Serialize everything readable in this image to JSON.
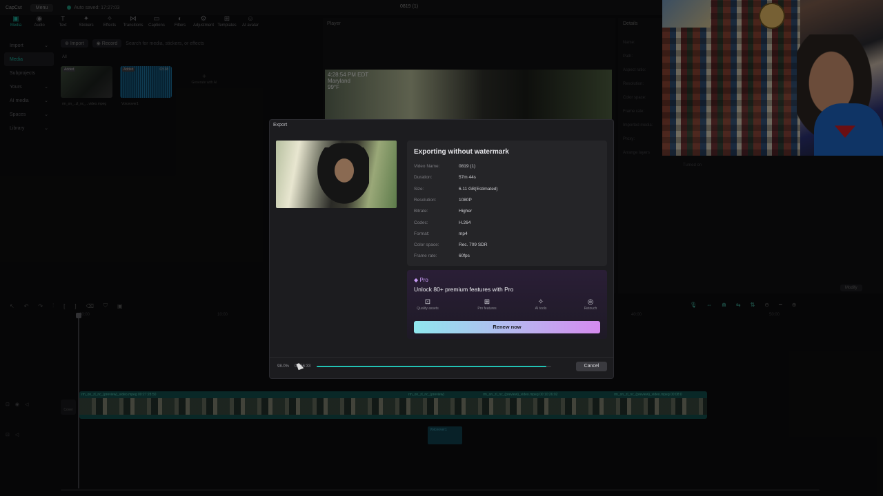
{
  "topbar": {
    "logo": "CapCut",
    "menu": "Menu",
    "autosave": "Auto saved: 17:27:03",
    "window_title": "0819 (1)"
  },
  "toolbar": [
    "Media",
    "Audio",
    "Text",
    "Stickers",
    "Effects",
    "Transitions",
    "Captions",
    "Filters",
    "Adjustment",
    "Templates",
    "AI avatar"
  ],
  "toolbar_icons": [
    "▣",
    "◉",
    "T",
    "✦",
    "✧",
    "⋈",
    "▭",
    "◐",
    "⚙",
    "⊞",
    "☺"
  ],
  "leftnav": [
    "Import",
    "Media",
    "Subprojects",
    "Yours",
    "AI media",
    "Spaces",
    "Library"
  ],
  "media": {
    "import": "Import",
    "record": "Record",
    "search_placeholder": "Search for media, stickers, or effects",
    "all": "All",
    "added": "Added",
    "thumb1_name": "rm_on_..zl_nc_...video.mpeg",
    "thumb2_name": "Voiceover1",
    "thumb2_duration": "03:38",
    "import_ai": "Generate with AI"
  },
  "player": {
    "label": "Player",
    "overlay_time": "4:28:54 PM EDT",
    "overlay_place": "Maryland",
    "overlay_temp": "99°F"
  },
  "details": {
    "label": "Details",
    "lines": [
      "Name:",
      "Path:",
      "Aspect ratio:",
      "Resolution:",
      "Color space:",
      "Frame rate:",
      "Imported media:",
      "Proxy:",
      "Arrange layers"
    ],
    "arrange_value": "Turned on",
    "modify": "Modify"
  },
  "timeline": {
    "ruler_labels": [
      "00:00",
      "10:00",
      "20:00",
      "30:00",
      "40:00",
      "50:00"
    ],
    "clip_labels": [
      "rm_on_zl_nc_(preview)_video.mpeg   00:27:28:50",
      "rm_on_zl_nc_(preview)",
      "rm_on_zl_nc_(preview)_video.mpeg   00:10:26:02",
      "rm_on_zl_nc_(preview)_video.mpeg   00:08:0"
    ],
    "cover": "Cover",
    "voice_clip": "Voiceover1"
  },
  "export_modal": {
    "title": "Export",
    "heading": "Exporting without watermark",
    "rows": [
      {
        "k": "Video Name:",
        "v": "0819 (1)"
      },
      {
        "k": "Duration:",
        "v": "57m 44s"
      },
      {
        "k": "Size:",
        "v": "6.11 GB(Estimated)"
      },
      {
        "k": "Resolution:",
        "v": "1080P"
      },
      {
        "k": "Bitrate:",
        "v": "Higher"
      },
      {
        "k": "Codec:",
        "v": "H.264"
      },
      {
        "k": "Format:",
        "v": "mp4"
      },
      {
        "k": "Color space:",
        "v": "Rec. 709 SDR"
      },
      {
        "k": "Frame rate:",
        "v": "60fps"
      }
    ],
    "pro_badge": "Pro",
    "pro_title": "Unlock 80+ premium features with Pro",
    "pro_features": [
      {
        "icon": "quality-assets-icon",
        "glyph": "⊡",
        "label": "Quality assets"
      },
      {
        "icon": "pro-features-icon",
        "glyph": "⊞",
        "label": "Pro features"
      },
      {
        "icon": "ai-tools-icon",
        "glyph": "✧",
        "label": "AI tools"
      },
      {
        "icon": "retouch-icon",
        "glyph": "◎",
        "label": "Retouch"
      }
    ],
    "renew": "Renew now",
    "progress_pct": "98.0%",
    "progress_time": "00:56:33",
    "progress_fraction": 0.98,
    "cancel": "Cancel"
  },
  "colors": {
    "accent": "#22c3b4",
    "pro": "#c79cf5"
  }
}
